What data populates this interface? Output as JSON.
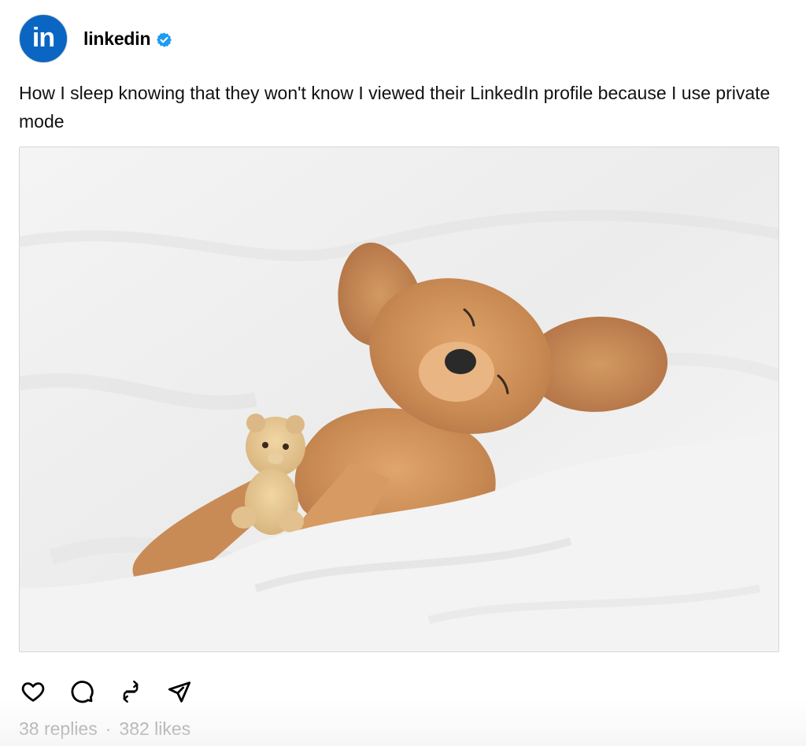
{
  "post": {
    "author": {
      "avatar_text": "in",
      "avatar_color": "#0a66c2",
      "username": "linkedin",
      "verified": true,
      "verified_color": "#1d9bf0"
    },
    "caption": "How I sleep knowing that they won't know I viewed their LinkedIn profile because I use private mode",
    "image": {
      "content": "photo of a golden puppy sleeping on its back on white bedding, hugging a small teddy bear"
    },
    "actions": [
      {
        "name": "like",
        "icon": "heart-icon"
      },
      {
        "name": "reply",
        "icon": "comment-icon"
      },
      {
        "name": "repost",
        "icon": "repost-icon"
      },
      {
        "name": "share",
        "icon": "send-icon"
      }
    ],
    "stats": {
      "replies": "38 replies",
      "separator": "·",
      "likes": "382 likes"
    }
  }
}
